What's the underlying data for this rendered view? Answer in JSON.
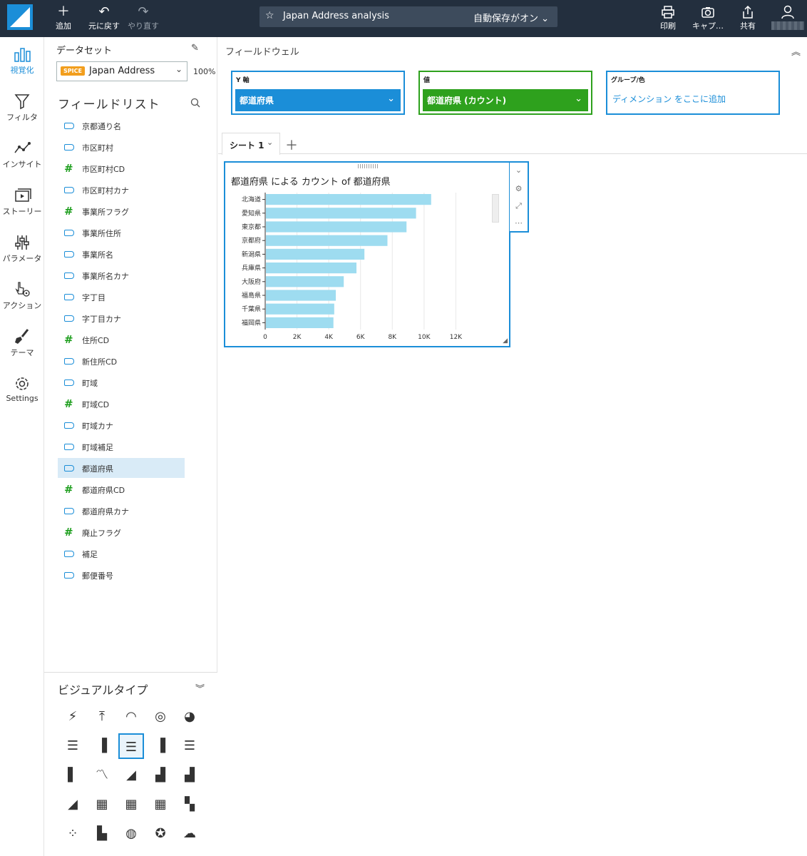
{
  "toolbar": {
    "add": "追加",
    "undo": "元に戻す",
    "redo": "やり直す",
    "analysis_title": "Japan Address analysis",
    "autosave": "自動保存がオン",
    "print": "印刷",
    "capture": "キャプ…",
    "share": "共有"
  },
  "nav": {
    "visualize": "視覚化",
    "filter": "フィルタ",
    "insight": "インサイト",
    "story": "ストーリー",
    "parameter": "パラメータ",
    "action": "アクション",
    "theme": "テーマ",
    "settings": "Settings"
  },
  "dataset": {
    "label": "データセット",
    "badge": "SPICE",
    "name": "Japan Address",
    "percent": "100%"
  },
  "field_list": {
    "title": "フィールドリスト",
    "fields": [
      {
        "label": "京都通り名",
        "type": "dim"
      },
      {
        "label": "市区町村",
        "type": "dim"
      },
      {
        "label": "市区町村CD",
        "type": "num"
      },
      {
        "label": "市区町村カナ",
        "type": "dim"
      },
      {
        "label": "事業所フラグ",
        "type": "num"
      },
      {
        "label": "事業所住所",
        "type": "dim"
      },
      {
        "label": "事業所名",
        "type": "dim"
      },
      {
        "label": "事業所名カナ",
        "type": "dim"
      },
      {
        "label": "字丁目",
        "type": "dim"
      },
      {
        "label": "字丁目カナ",
        "type": "dim"
      },
      {
        "label": "住所CD",
        "type": "num"
      },
      {
        "label": "新住所CD",
        "type": "dim"
      },
      {
        "label": "町域",
        "type": "dim"
      },
      {
        "label": "町域CD",
        "type": "num"
      },
      {
        "label": "町域カナ",
        "type": "dim"
      },
      {
        "label": "町域補足",
        "type": "dim"
      },
      {
        "label": "都道府県",
        "type": "dim",
        "selected": true
      },
      {
        "label": "都道府県CD",
        "type": "num"
      },
      {
        "label": "都道府県カナ",
        "type": "dim"
      },
      {
        "label": "廃止フラグ",
        "type": "num"
      },
      {
        "label": "補足",
        "type": "dim"
      },
      {
        "label": "郵便番号",
        "type": "dim"
      }
    ]
  },
  "visual_types": {
    "title": "ビジュアルタイプ"
  },
  "field_wells": {
    "label": "フィールドウェル",
    "y_axis": {
      "label": "Y 軸",
      "value": "都道府県"
    },
    "value": {
      "label": "値",
      "value": "都道府県 (カウント)"
    },
    "group": {
      "label": "グループ/色",
      "placeholder": "ディメンション をここに追加"
    }
  },
  "sheet": {
    "tab": "シート 1"
  },
  "colors": {
    "accent": "#1b8ed8",
    "well_green": "#2ea11d",
    "bar": "#9edcf0",
    "topbar": "#232f3e"
  },
  "chart_data": {
    "type": "bar",
    "orientation": "horizontal",
    "title": "都道府県 による カウント of 都道府県",
    "categories": [
      "北海道",
      "愛知県",
      "東京都",
      "京都府",
      "新潟県",
      "兵庫県",
      "大阪府",
      "福島県",
      "千葉県",
      "福岡県"
    ],
    "values": [
      10400,
      9450,
      8850,
      7650,
      6200,
      5700,
      4900,
      4400,
      4300,
      4250
    ],
    "xlim": [
      0,
      14000
    ],
    "xticks": [
      "0",
      "2K",
      "4K",
      "6K",
      "8K",
      "10K",
      "12K"
    ],
    "grid": true
  }
}
